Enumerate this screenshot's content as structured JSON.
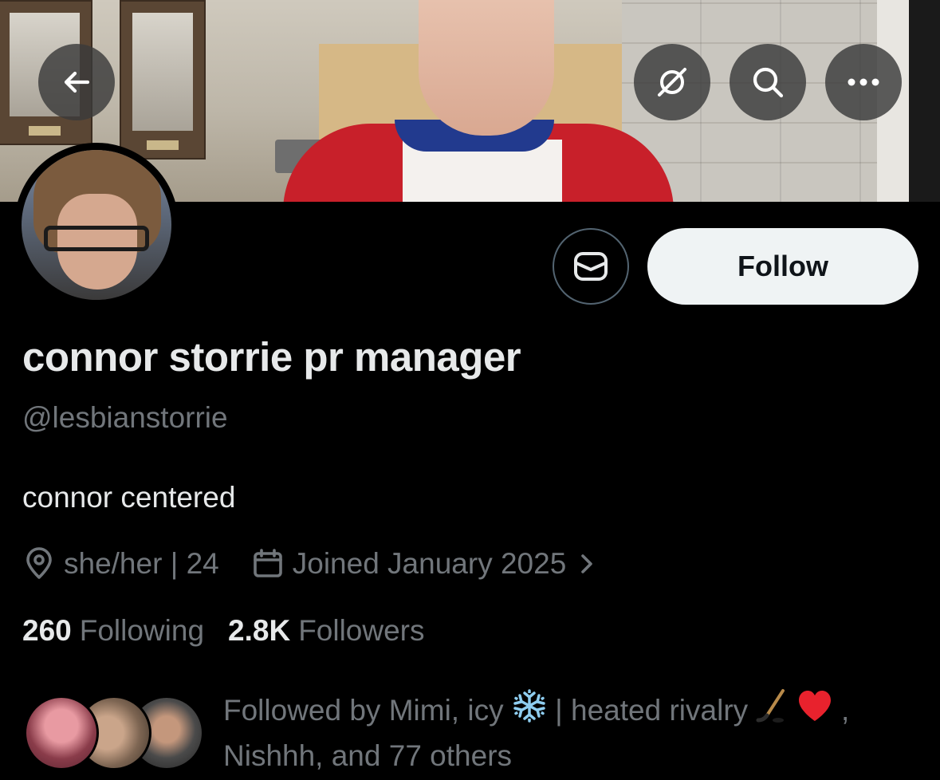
{
  "profile": {
    "display_name": "connor storrie pr manager",
    "handle": "@lesbianstorrie",
    "bio": "connor centered",
    "location": "she/her | 24",
    "joined": "Joined January 2025"
  },
  "actions": {
    "follow_label": "Follow"
  },
  "stats": {
    "following_count": "260",
    "following_label": "Following",
    "followers_count": "2.8K",
    "followers_label": "Followers"
  },
  "followed_by": {
    "prefix": "Followed by Mimi, icy",
    "middle": "| heated rivalry",
    "comma": ",",
    "suffix": "Nishhh, and 77 others"
  },
  "icons": {
    "back": "arrow-left-icon",
    "grok": "grok-icon",
    "search": "search-icon",
    "more": "more-dots-icon",
    "message": "envelope-icon",
    "location": "location-pin-icon",
    "calendar": "calendar-icon",
    "chevron": "chevron-right-icon",
    "snowflake": "snowflake-emoji",
    "hockey": "hockey-stick-emoji",
    "heart": "red-heart-emoji"
  },
  "colors": {
    "background": "#000000",
    "primary_text": "#e7e9ea",
    "secondary_text": "#71767b",
    "follow_button_bg": "#eff3f4",
    "follow_button_text": "#0f1419",
    "button_border": "#536471"
  }
}
